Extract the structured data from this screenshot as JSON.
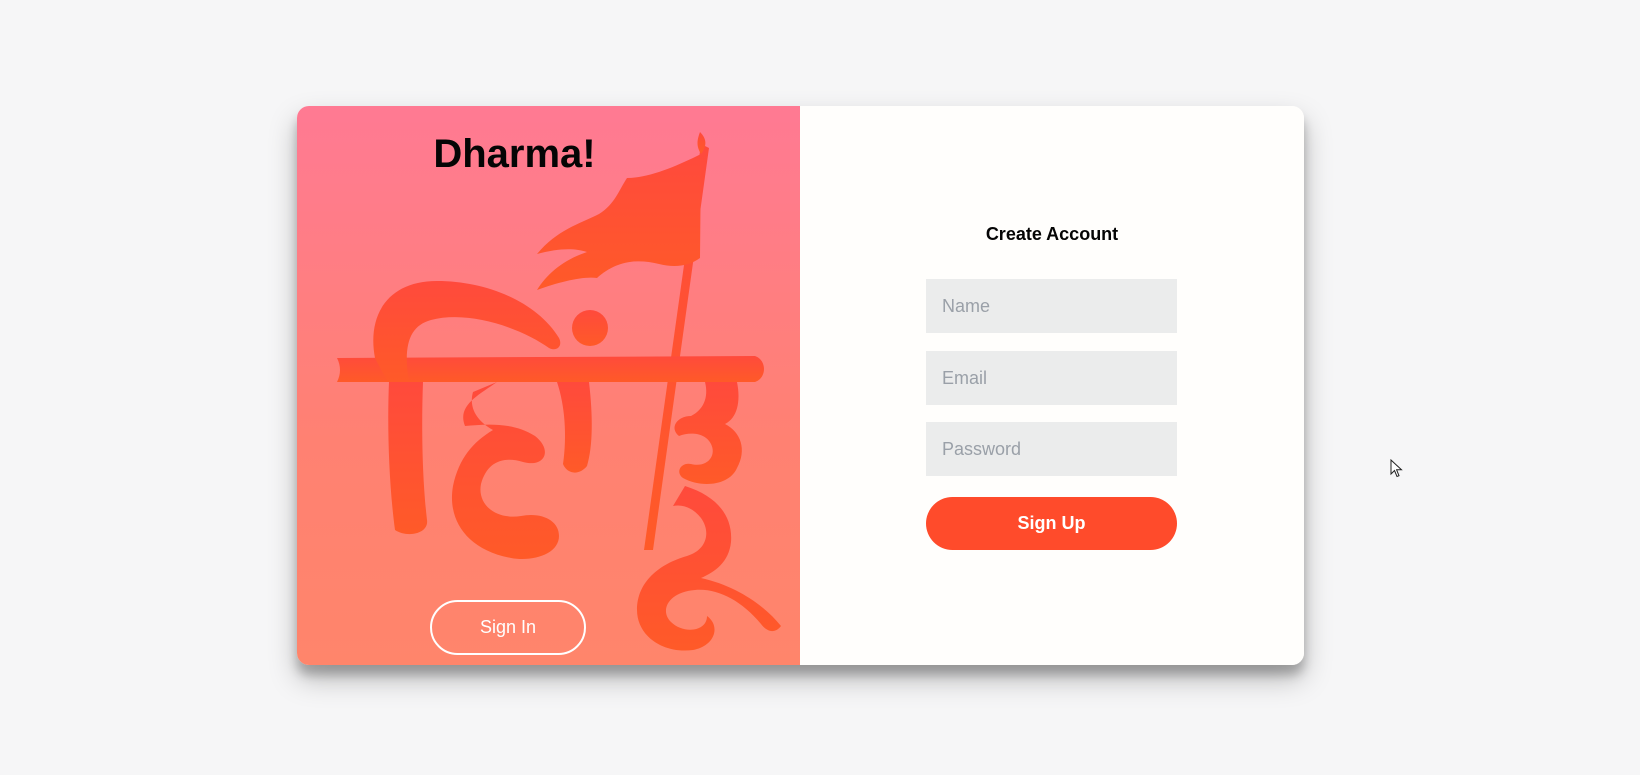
{
  "left_panel": {
    "title": "Dharma!",
    "signin_label": "Sign In",
    "artwork": "hindu-script-with-saffron-flag",
    "art_color": "#ff5430"
  },
  "signup_form": {
    "title": "Create Account",
    "name_placeholder": "Name",
    "email_placeholder": "Email",
    "password_placeholder": "Password",
    "submit_label": "Sign Up",
    "accent_color": "#ff4b2b"
  },
  "cursor": "mouse-pointer-icon"
}
